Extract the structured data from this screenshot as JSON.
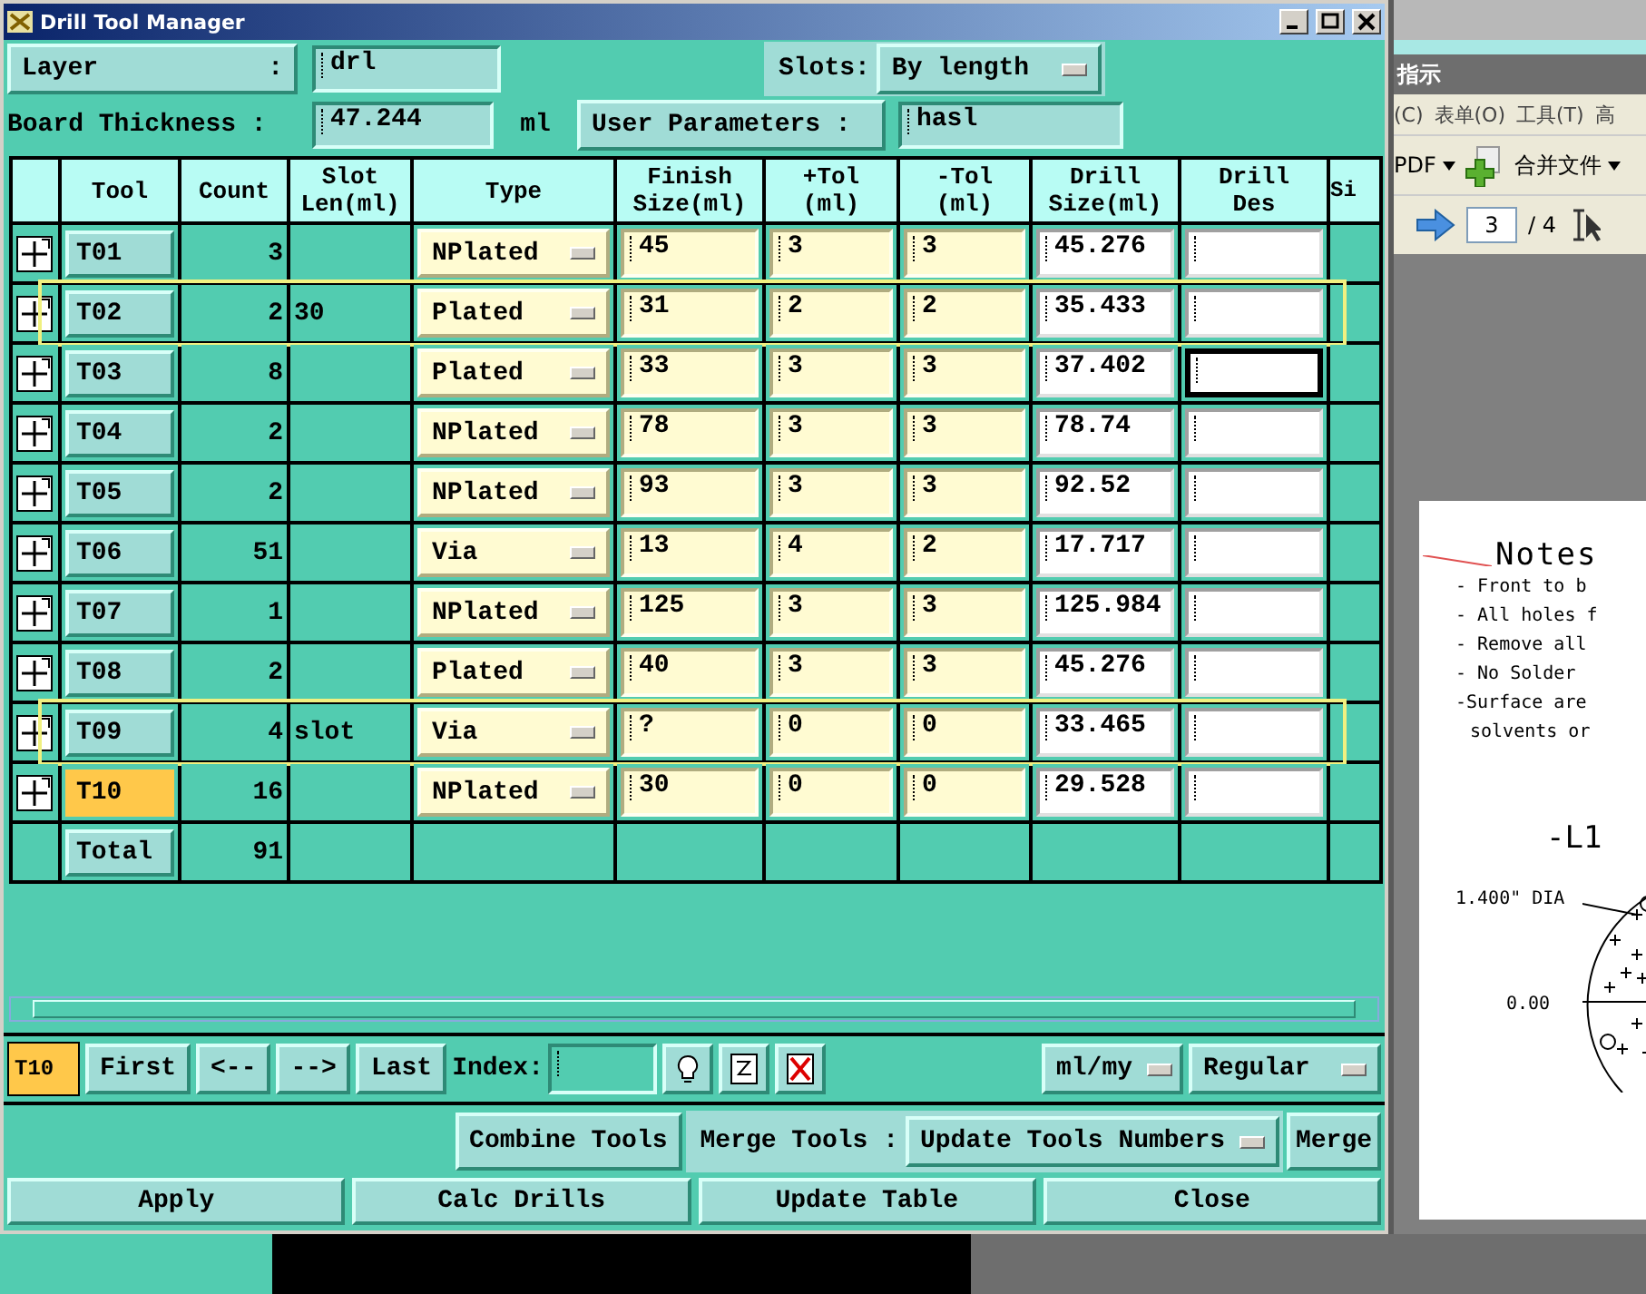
{
  "window": {
    "title": "Drill Tool Manager"
  },
  "layer": {
    "label": "Layer",
    "suffix": ":",
    "value": "drl"
  },
  "slots": {
    "label": "Slots:",
    "value": "By length"
  },
  "board_thickness": {
    "label": "Board Thickness :",
    "value": "47.244",
    "unit": "ml"
  },
  "user_parameters": {
    "label": "User Parameters :",
    "value": "hasl"
  },
  "table": {
    "columns": [
      "Tool",
      "Count",
      "Slot\nLen(ml)",
      "Type",
      "Finish\nSize(ml)",
      "+Tol\n(ml)",
      "-Tol\n(ml)",
      "Drill\nSize(ml)",
      "Drill\nDes",
      "Si"
    ],
    "rows": [
      {
        "tool": "T01",
        "selected": false,
        "count": "3",
        "type": "NPlated",
        "finish": "45",
        "plus_tol": "3",
        "minus_tol": "3",
        "drill_size": "45.276",
        "focused": false,
        "highlighted": false
      },
      {
        "tool": "T02",
        "selected": false,
        "count": "2",
        "slot_len": "30",
        "type": "Plated",
        "finish": "31",
        "plus_tol": "2",
        "minus_tol": "2",
        "drill_size": "35.433",
        "focused": false,
        "highlighted": true
      },
      {
        "tool": "T03",
        "selected": false,
        "count": "8",
        "type": "Plated",
        "finish": "33",
        "plus_tol": "3",
        "minus_tol": "3",
        "drill_size": "37.402",
        "focused": true,
        "highlighted": false
      },
      {
        "tool": "T04",
        "selected": false,
        "count": "2",
        "type": "NPlated",
        "finish": "78",
        "plus_tol": "3",
        "minus_tol": "3",
        "drill_size": "78.74",
        "focused": false,
        "highlighted": false
      },
      {
        "tool": "T05",
        "selected": false,
        "count": "2",
        "type": "NPlated",
        "finish": "93",
        "plus_tol": "3",
        "minus_tol": "3",
        "drill_size": "92.52",
        "focused": false,
        "highlighted": false
      },
      {
        "tool": "T06",
        "selected": false,
        "count": "51",
        "type": "Via",
        "finish": "13",
        "plus_tol": "4",
        "minus_tol": "2",
        "drill_size": "17.717",
        "focused": false,
        "highlighted": false
      },
      {
        "tool": "T07",
        "selected": false,
        "count": "1",
        "type": "NPlated",
        "finish": "125",
        "plus_tol": "3",
        "minus_tol": "3",
        "drill_size": "125.984",
        "focused": false,
        "highlighted": false
      },
      {
        "tool": "T08",
        "selected": false,
        "count": "2",
        "type": "Plated",
        "finish": "40",
        "plus_tol": "3",
        "minus_tol": "3",
        "drill_size": "45.276",
        "focused": false,
        "highlighted": false
      },
      {
        "tool": "T09",
        "selected": false,
        "count": "4",
        "slot_len": "slot",
        "type": "Via",
        "finish": "?",
        "plus_tol": "0",
        "minus_tol": "0",
        "drill_size": "33.465",
        "focused": false,
        "highlighted": true
      },
      {
        "tool": "T10",
        "selected": true,
        "count": "16",
        "type": "NPlated",
        "finish": "30",
        "plus_tol": "0",
        "minus_tol": "0",
        "drill_size": "29.528",
        "focused": false,
        "highlighted": false
      }
    ],
    "total": {
      "label": "Total",
      "count": "91"
    }
  },
  "toolbar": {
    "current": "T10",
    "nav": [
      "First",
      "<--",
      "-->",
      "Last"
    ],
    "index_label": "Index:",
    "units": "ml/my",
    "mode": "Regular"
  },
  "merge": {
    "combine": "Combine Tools",
    "label": "Merge Tools :",
    "option": "Update Tools Numbers",
    "button": "Merge"
  },
  "actions": [
    "Apply",
    "Calc Drills",
    "Update Table",
    "Close"
  ],
  "viewer": {
    "title": "指示",
    "menu": [
      "(C)",
      "表单(O)",
      "工具(T)",
      "高"
    ],
    "create": "PDF",
    "combine": "合并文件",
    "page": "3",
    "page_count": "/ 4",
    "document": {
      "heading": "Notes",
      "notes": [
        "- Front to b",
        "- All holes f",
        "- Remove all",
        "- No Solder",
        "-Surface are",
        "solvents or"
      ],
      "figure_title": "-L1",
      "dimension": "1.400\" DIA",
      "axis": "0.00"
    }
  }
}
